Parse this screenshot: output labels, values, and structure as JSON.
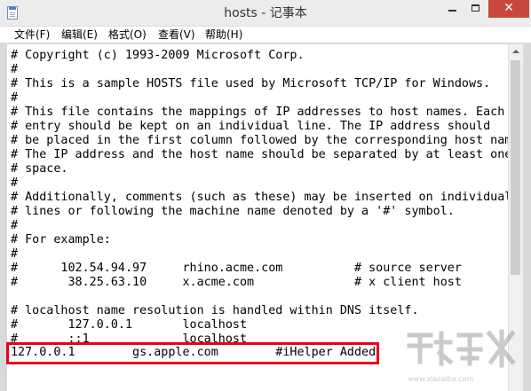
{
  "window": {
    "title": "hosts - 记事本",
    "close_glyph": "✕"
  },
  "menu": {
    "items": [
      "文件(F)",
      "编辑(E)",
      "格式(O)",
      "查看(V)",
      "帮助(H)"
    ]
  },
  "editor": {
    "lines": [
      "# Copyright (c) 1993-2009 Microsoft Corp.",
      "#",
      "# This is a sample HOSTS file used by Microsoft TCP/IP for Windows.",
      "#",
      "# This file contains the mappings of IP addresses to host names. Each",
      "# entry should be kept on an individual line. The IP address should",
      "# be placed in the first column followed by the corresponding host name.",
      "# The IP address and the host name should be separated by at least one",
      "# space.",
      "#",
      "# Additionally, comments (such as these) may be inserted on individual",
      "# lines or following the machine name denoted by a '#' symbol.",
      "#",
      "# For example:",
      "#",
      "#      102.54.94.97     rhino.acme.com          # source server",
      "#       38.25.63.10     x.acme.com              # x client host",
      "",
      "# localhost name resolution is handled within DNS itself.",
      "#\t127.0.0.1       localhost",
      "#\t::1             localhost",
      "127.0.0.1        gs.apple.com        #iHelper Added"
    ]
  },
  "colors": {
    "highlight": "#e6001e",
    "close_button": "#c7473a"
  }
}
